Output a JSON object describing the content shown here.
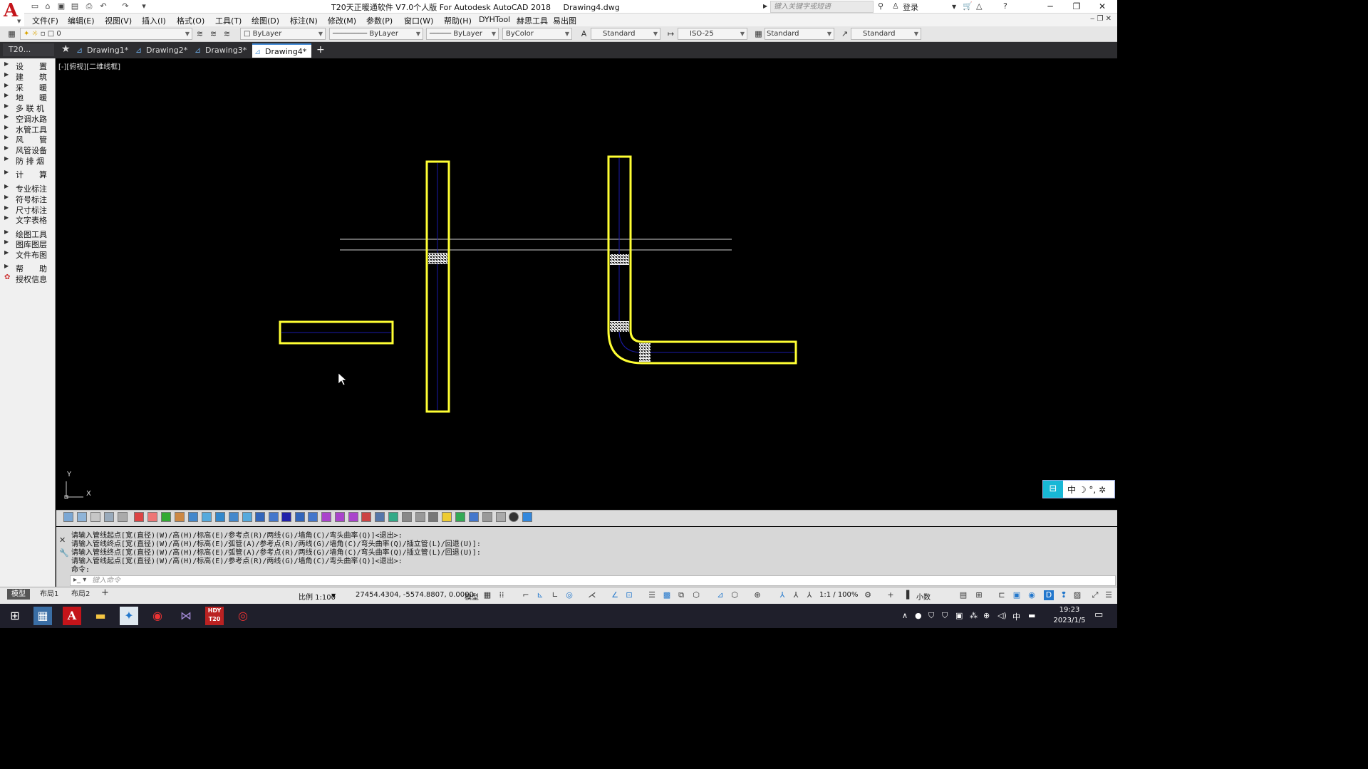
{
  "app": {
    "title": "T20天正暖通软件 V7.0个人版 For Autodesk AutoCAD 2018     Drawing4.dwg",
    "search_placeholder": "键入关键字或短语",
    "login": "登录"
  },
  "menu": [
    "文件(F)",
    "编辑(E)",
    "视图(V)",
    "插入(I)",
    "格式(O)",
    "工具(T)",
    "绘图(D)",
    "标注(N)",
    "修改(M)",
    "参数(P)",
    "窗口(W)",
    "帮助(H)",
    "DYHTool",
    "赫思工具",
    "易出图"
  ],
  "toolbar": {
    "layer": "0",
    "color": "ByLayer",
    "linetype": "ByLayer",
    "lineweight": "ByLayer",
    "plotstyle": "ByColor",
    "text_style": "Standard",
    "dim_style": "ISO-25",
    "table_style": "Standard",
    "mleader_style": "Standard"
  },
  "tabs": {
    "panel_label": "T20...",
    "documents": [
      "Drawing1*",
      "Drawing2*",
      "Drawing3*",
      "Drawing4*"
    ],
    "active": "Drawing4*"
  },
  "palette": [
    "设　　置",
    "建　　筑",
    "采　　暖",
    "地　　暖",
    "多 联 机",
    "空调水路",
    "水管工具",
    "风　　管",
    "风管设备",
    "防 排 烟",
    "计　　算",
    "专业标注",
    "符号标注",
    "尺寸标注",
    "文字表格",
    "绘图工具",
    "图库图层",
    "文件布图",
    "帮　　助",
    "授权信息"
  ],
  "viewport": {
    "label": "[-][俯视][二维线框]",
    "ucs_x": "X",
    "ucs_y": "Y"
  },
  "command": {
    "history": [
      "请输入管线起点[宽(直径)(W)/高(H)/标高(E)/参考点(R)/两线(G)/墙角(C)/弯头曲率(Q)]<退出>:",
      "请输入管线终点[宽(直径)(W)/高(H)/标高(E)/弧管(A)/参考点(R)/两线(G)/墙角(C)/弯头曲率(Q)/插立管(L)/回退(U)]:",
      "请输入管线终点[宽(直径)(W)/高(H)/标高(E)/弧管(A)/参考点(R)/两线(G)/墙角(C)/弯头曲率(Q)/插立管(L)/回退(U)]:",
      "请输入管线起点[宽(直径)(W)/高(H)/标高(E)/参考点(R)/两线(G)/墙角(C)/弯头曲率(Q)]<退出>:",
      "命令:"
    ],
    "input_placeholder": "键入命令"
  },
  "status": {
    "layouts": [
      "模型",
      "布局1",
      "布局2"
    ],
    "scale": "比例 1:100",
    "coords": "27454.4304, -5574.8807, 0.0000",
    "model": "模型",
    "annotation_scale": "1:1 / 100%",
    "units": "小数"
  },
  "ime": {
    "text": "中 ☽ °, ✲"
  },
  "clock": {
    "time": "19:23",
    "date": "2023/1/5"
  },
  "tray": {
    "lang": "中"
  },
  "colors": {
    "duct_outline": "#ffff33",
    "duct_center": "#1a1aa8",
    "reference_line": "#d0d0d0"
  }
}
